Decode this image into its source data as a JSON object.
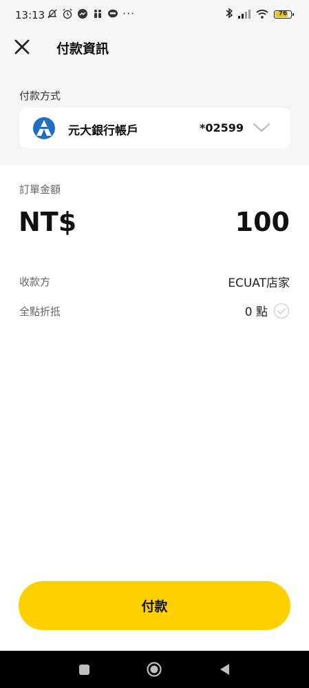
{
  "status_bar": {
    "time": "13:13",
    "dots": "···",
    "battery": "76",
    "icons_left": [
      "muted-notification-icon",
      "alarm-icon",
      "messenger-icon",
      "people-icon",
      "line-icon"
    ],
    "icons_right": [
      "bluetooth-icon",
      "signal-icon",
      "wifi-icon",
      "battery-icon"
    ]
  },
  "header": {
    "title": "付款資訊"
  },
  "payment_method": {
    "label": "付款方式",
    "bank_name": "元大銀行帳戶",
    "account": "*02599"
  },
  "order": {
    "label": "訂單金額",
    "currency": "NT$",
    "amount": "100"
  },
  "payee": {
    "label": "收款方",
    "value": "ECUAT店家"
  },
  "points": {
    "label": "全點折抵",
    "value": "0 點"
  },
  "actions": {
    "pay_label": "付款"
  },
  "colors": {
    "accent": "#ffd000",
    "top_background": "#f5f5f5",
    "bank_logo_blue": "#1f6fc4"
  }
}
